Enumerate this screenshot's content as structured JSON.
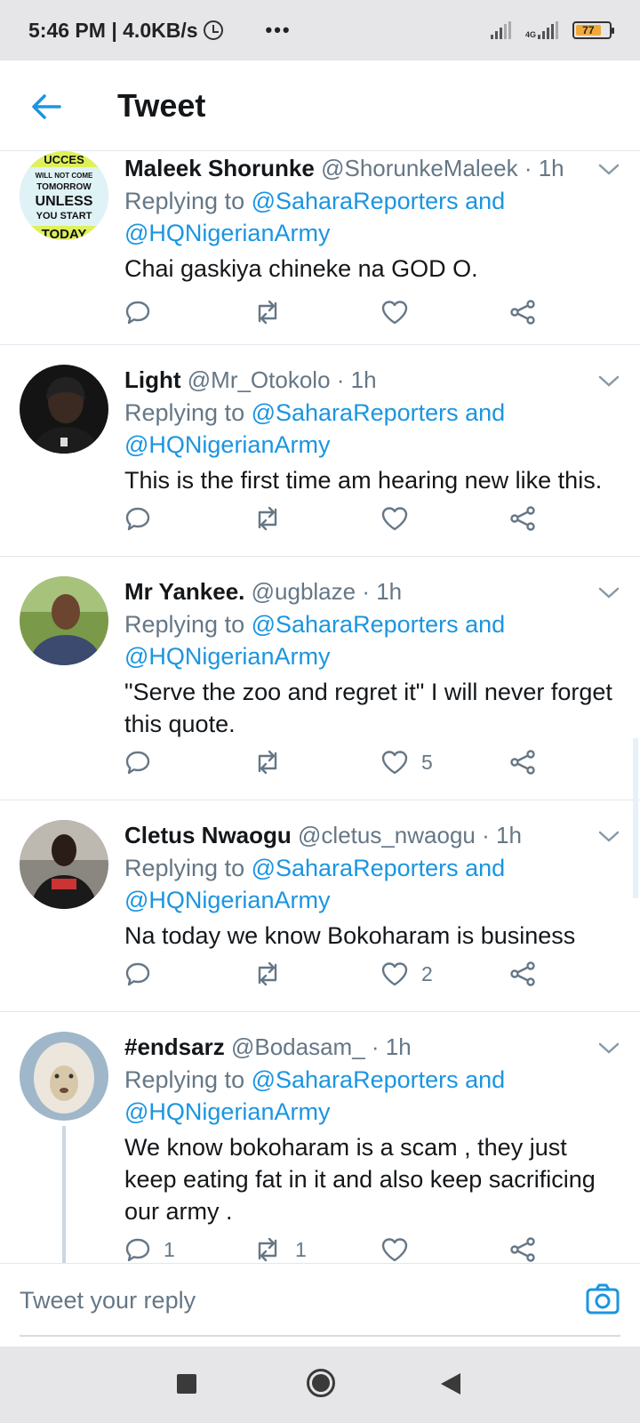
{
  "status_bar": {
    "time_speed": "5:46 PM | 4.0KB/s",
    "more": "•••",
    "network": "4G",
    "battery": "77"
  },
  "header": {
    "title": "Tweet"
  },
  "tweets": [
    {
      "name": "Maleek Shorunke",
      "handle": "@ShorunkeMaleek · 1h",
      "reply_prefix": "Replying to ",
      "reply_users_line1": "@SaharaReporters and",
      "reply_users_line2": "@HQNigerianArmy",
      "text": "Chai gaskiya chineke na GOD O.",
      "reply_count": "",
      "retweet_count": "",
      "like_count": "",
      "avatar_text": [
        "UCCES",
        "WILL NOT COME",
        "TOMORROW",
        "UNLESS",
        "YOU START",
        "TODAY"
      ]
    },
    {
      "name": "Light",
      "handle": "@Mr_Otokolo · 1h",
      "reply_prefix": "Replying to ",
      "reply_users_line1": "@SaharaReporters and",
      "reply_users_line2": "@HQNigerianArmy",
      "text": "This is the first time am hearing new like this.",
      "reply_count": "",
      "retweet_count": "",
      "like_count": ""
    },
    {
      "name": "Mr Yankee.",
      "handle": "@ugblaze · 1h",
      "reply_prefix": "Replying to ",
      "reply_users_line1": "@SaharaReporters and",
      "reply_users_line2": "@HQNigerianArmy",
      "text": "\"Serve the zoo and regret it\" I will never forget this quote.",
      "reply_count": "",
      "retweet_count": "",
      "like_count": "5"
    },
    {
      "name": "Cletus Nwaogu",
      "handle": "@cletus_nwaogu · 1h",
      "reply_prefix": "Replying to ",
      "reply_users_line1": "@SaharaReporters and",
      "reply_users_line2": "@HQNigerianArmy",
      "text": "Na today we know Bokoharam is business",
      "reply_count": "",
      "retweet_count": "",
      "like_count": "2"
    },
    {
      "name": "#endsarz",
      "handle": "@Bodasam_ · 1h",
      "reply_prefix": "Replying to ",
      "reply_users_line1": "@SaharaReporters and",
      "reply_users_line2": "@HQNigerianArmy",
      "text": "We know bokoharam is a scam , they just keep eating fat in it and also keep sacrificing our army .",
      "reply_count": "1",
      "retweet_count": "1",
      "like_count": ""
    }
  ],
  "reply_bar": {
    "placeholder": "Tweet your reply"
  },
  "colors": {
    "accent": "#1b95e0",
    "muted": "#657786",
    "text": "#14171a"
  }
}
